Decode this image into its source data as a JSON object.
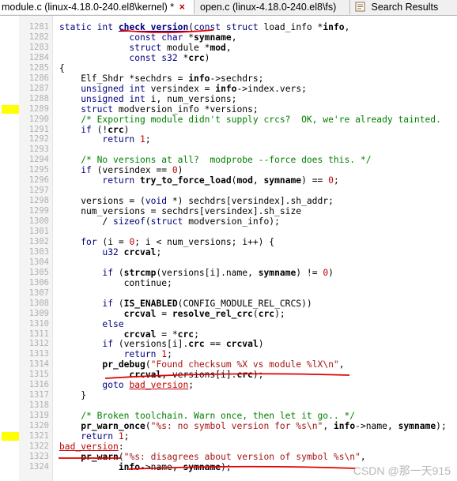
{
  "tabs": [
    {
      "label": "module.c (linux-4.18.0-240.el8\\kernel) *",
      "close": "×"
    },
    {
      "label": "open.c (linux-4.18.0-240.el8\\fs)"
    },
    {
      "label": "Search Results"
    }
  ],
  "lines": [
    {
      "n": "1281",
      "t": "static int check_version(const struct load_info *info,"
    },
    {
      "n": "1282",
      "t": "             const char *symname,"
    },
    {
      "n": "1283",
      "t": "             struct module *mod,"
    },
    {
      "n": "1284",
      "t": "             const s32 *crc)"
    },
    {
      "n": "1285",
      "t": "{"
    },
    {
      "n": "1286",
      "t": "    Elf_Shdr *sechdrs = info->sechdrs;"
    },
    {
      "n": "1287",
      "t": "    unsigned int versindex = info->index.vers;"
    },
    {
      "n": "1288",
      "t": "    unsigned int i, num_versions;"
    },
    {
      "n": "1289",
      "t": "    struct modversion_info *versions;"
    },
    {
      "n": "1290",
      "t": "    /* Exporting module didn't supply crcs?  OK, we're already tainted."
    },
    {
      "n": "1291",
      "t": "    if (!crc)"
    },
    {
      "n": "1292",
      "t": "        return 1;"
    },
    {
      "n": "1293",
      "t": ""
    },
    {
      "n": "1294",
      "t": "    /* No versions at all?  modprobe --force does this. */"
    },
    {
      "n": "1295",
      "t": "    if (versindex == 0)"
    },
    {
      "n": "1296",
      "t": "        return try_to_force_load(mod, symname) == 0;"
    },
    {
      "n": "1297",
      "t": ""
    },
    {
      "n": "1298",
      "t": "    versions = (void *) sechdrs[versindex].sh_addr;"
    },
    {
      "n": "1299",
      "t": "    num_versions = sechdrs[versindex].sh_size"
    },
    {
      "n": "1300",
      "t": "        / sizeof(struct modversion_info);"
    },
    {
      "n": "1301",
      "t": ""
    },
    {
      "n": "1302",
      "t": "    for (i = 0; i < num_versions; i++) {"
    },
    {
      "n": "1303",
      "t": "        u32 crcval;"
    },
    {
      "n": "1304",
      "t": ""
    },
    {
      "n": "1305",
      "t": "        if (strcmp(versions[i].name, symname) != 0)"
    },
    {
      "n": "1306",
      "t": "            continue;"
    },
    {
      "n": "1307",
      "t": ""
    },
    {
      "n": "1308",
      "t": "        if (IS_ENABLED(CONFIG_MODULE_REL_CRCS))"
    },
    {
      "n": "1309",
      "t": "            crcval = resolve_rel_crc(crc);"
    },
    {
      "n": "1310",
      "t": "        else"
    },
    {
      "n": "1311",
      "t": "            crcval = *crc;"
    },
    {
      "n": "1312",
      "t": "        if (versions[i].crc == crcval)"
    },
    {
      "n": "1313",
      "t": "            return 1;"
    },
    {
      "n": "1314",
      "t": "        pr_debug(\"Found checksum %X vs module %lX\\n\","
    },
    {
      "n": "1315",
      "t": "             crcval, versions[i].crc);"
    },
    {
      "n": "1316",
      "t": "        goto bad_version;"
    },
    {
      "n": "1317",
      "t": "    }"
    },
    {
      "n": "1318",
      "t": ""
    },
    {
      "n": "1319",
      "t": "    /* Broken toolchain. Warn once, then let it go.. */"
    },
    {
      "n": "1320",
      "t": "    pr_warn_once(\"%s: no symbol version for %s\\n\", info->name, symname);"
    },
    {
      "n": "1321",
      "t": "    return 1;"
    },
    {
      "n": "1322",
      "t": "bad_version:"
    },
    {
      "n": "1323",
      "t": "    pr_warn(\"%s: disagrees about version of symbol %s\\n\","
    },
    {
      "n": "1324",
      "t": "           info->name, symname);"
    }
  ],
  "watermark": "CSDN @那一天915",
  "colors": {
    "keyword": "#000080",
    "comment": "#008000",
    "number": "#c00000",
    "string": "#a31515",
    "marker": "#ffff00",
    "annotation": "#e00000"
  }
}
